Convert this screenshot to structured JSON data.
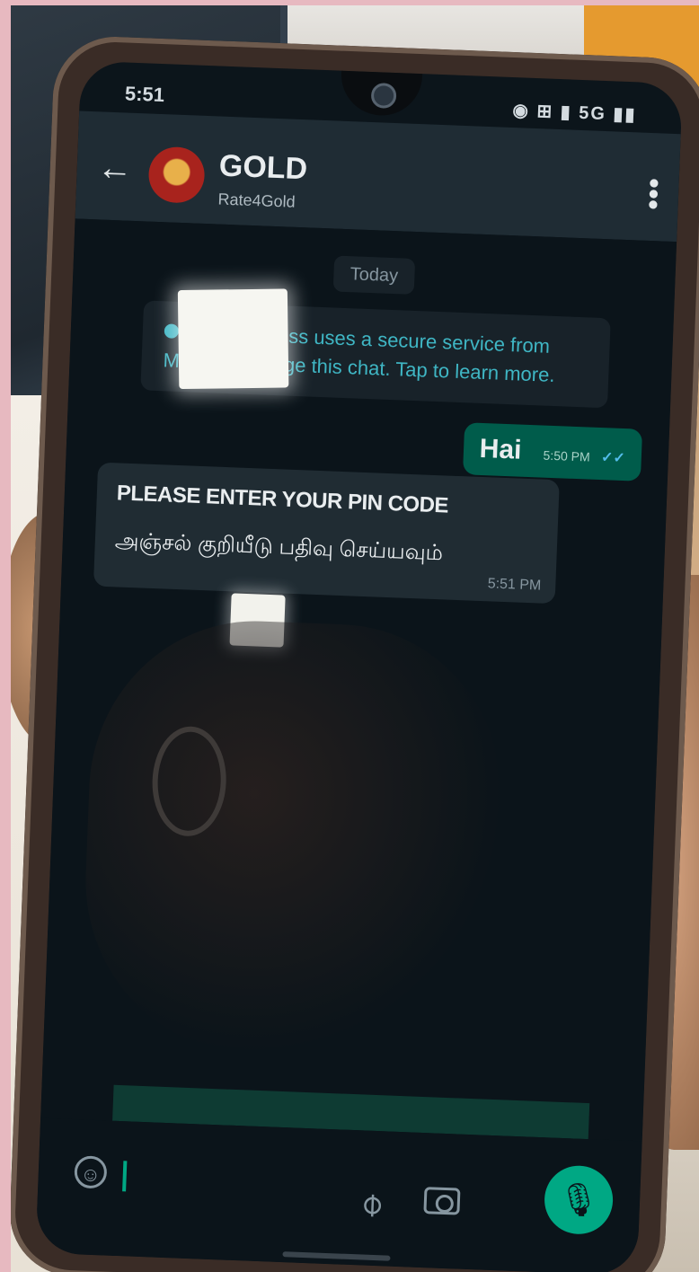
{
  "status_bar": {
    "time": "5:51",
    "icons": "◉ ⊞ ▮ 5G ▮▮"
  },
  "header": {
    "back_icon": "back-arrow-icon",
    "contact_name": "GOLD",
    "contact_subtitle": "Rate4Gold",
    "menu_icon": "more-vert-icon"
  },
  "chat": {
    "date_label": "Today",
    "system_message": "This business uses a secure service from Meta to manage this chat. Tap to learn more.",
    "outgoing": {
      "text": "Hai",
      "time": "5:50 PM",
      "ticks": "✓✓"
    },
    "incoming": {
      "line1": "PLEASE ENTER YOUR PIN CODE",
      "line2": "அஞ்சல் குறியீடு பதிவு செய்யவும்",
      "time": "5:51 PM"
    }
  },
  "input_bar": {
    "emoji_icon": "emoji-icon",
    "attach_icon": "paperclip-icon",
    "camera_icon": "camera-icon",
    "mic_icon": "microphone-icon"
  },
  "colors": {
    "header_bg": "#1f2c34",
    "chat_bg": "#0b141a",
    "outgoing_bubble": "#005c4b",
    "incoming_bubble": "#202c33",
    "accent": "#00a884"
  }
}
